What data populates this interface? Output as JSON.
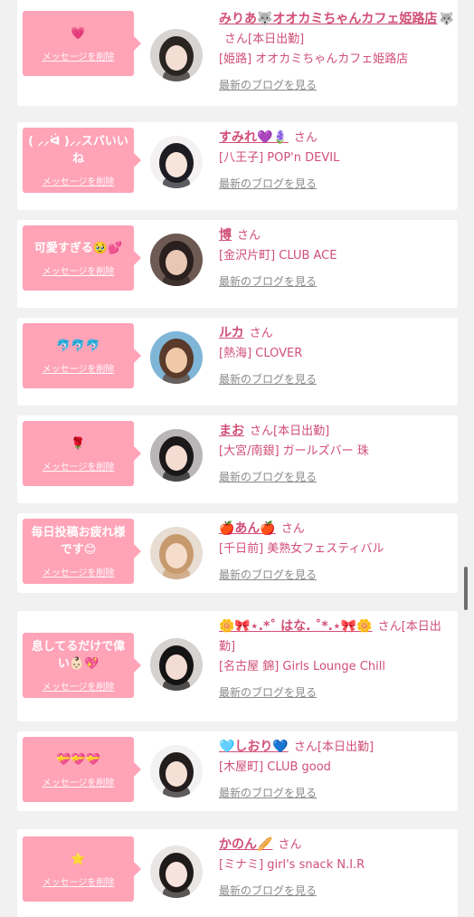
{
  "common": {
    "delete_label": "メッセージを削除",
    "blog_label": "最新のブログを見る",
    "san": "さん"
  },
  "items": [
    {
      "message": "💗",
      "name": "みりあ🐺オオカミちゃんカフェ姫路店",
      "name_suffix": "🐺",
      "badge": "[本日出勤]",
      "shop": "[姫路] オオカミちゃんカフェ姫路店"
    },
    {
      "message": "( ⸝⸝ᐛ )⸝⸝スバいいね",
      "name": "すみれ💜🪻",
      "badge": "",
      "shop": "[八王子] POP'n DEVIL"
    },
    {
      "message": "可愛すぎる🥹💕",
      "name": "博",
      "badge": "",
      "shop": "[金沢片町] CLUB ACE"
    },
    {
      "message": "🐬🐬🐬",
      "name": "ルカ",
      "badge": "",
      "shop": "[熱海] CLOVER"
    },
    {
      "message": "🌹",
      "name": "まお",
      "badge": "[本日出勤]",
      "shop": "[大宮/南銀] ガールズバー 珠"
    },
    {
      "message": "毎日投稿お疲れ様です😊",
      "name": "🍎あん🍎",
      "badge": "",
      "shop": "[千日前] 美熟女フェスティバル"
    },
    {
      "message": "息してるだけで偉い👶🏻💖",
      "name": "🌼🎀⋆.*˚ はな. ˚*.⋆🎀🌼",
      "badge": "[本日出勤]",
      "shop": "[名古屋 錦] Girls Lounge Chill"
    },
    {
      "message": "💝💝💝",
      "name": "🩵しおり💙",
      "badge": "[本日出勤]",
      "shop": "[木屋町] CLUB good"
    },
    {
      "message": "⭐",
      "name": "かのん🥖",
      "badge": "",
      "shop": "[ミナミ] girl's snack N.I.R"
    }
  ],
  "colors": {
    "accent": "#d14f77",
    "bubble": "#ffa3b7",
    "background": "#f1f1f1",
    "card": "#ffffff",
    "muted": "#8a8a8a"
  }
}
